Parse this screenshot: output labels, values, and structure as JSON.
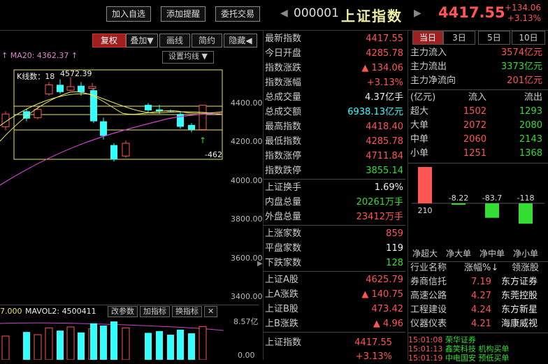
{
  "toolbar": {
    "add_favorite": "加入自选",
    "add_alert": "添加提醒",
    "entrust_trade": "委托交易"
  },
  "quote": {
    "code": "000001",
    "name": "上证指数",
    "price": "4417.55",
    "change": "+134.06",
    "change_pct": "+3.13%"
  },
  "chart": {
    "tabs": [
      "复权",
      "叠加▼",
      "画线",
      "简约",
      "隐藏◀"
    ],
    "ma20_label": "MA20: 4362.37",
    "set_ma_label": "设置均线",
    "kline_count_label": "K线数：18",
    "high_label": "4572.39",
    "low_label": "-462",
    "y_axis": [
      "4400.00",
      "4200.00",
      "4000.00",
      "3800.00",
      "3600.00",
      "3400.00"
    ],
    "vol_axis": [
      "8.57亿",
      "0.00"
    ],
    "vol_label_left": "7.000",
    "vol_label_mavol": "MAVOL2: 4500411",
    "vol_buttons": [
      "改参数",
      "加指标",
      "换指标",
      "✕"
    ]
  },
  "chart_data": {
    "type": "candlestick",
    "candles": [
      {
        "o": 4300,
        "c": 4370,
        "h": 4385,
        "l": 4280,
        "up": true
      },
      {
        "o": 4385,
        "c": 4345,
        "h": 4400,
        "l": 4330,
        "up": false
      },
      {
        "o": 4350,
        "c": 4395,
        "h": 4410,
        "l": 4340,
        "up": true
      },
      {
        "o": 4480,
        "c": 4530,
        "h": 4545,
        "l": 4470,
        "up": true
      },
      {
        "o": 4530,
        "c": 4490,
        "h": 4560,
        "l": 4480,
        "up": false
      },
      {
        "o": 4500,
        "c": 4520,
        "h": 4572,
        "l": 4495,
        "up": true
      },
      {
        "o": 4525,
        "c": 4490,
        "h": 4545,
        "l": 4470,
        "up": false
      },
      {
        "o": 4510,
        "c": 4520,
        "h": 4540,
        "l": 4490,
        "up": true
      },
      {
        "o": 4500,
        "c": 4330,
        "h": 4510,
        "l": 4320,
        "up": false
      },
      {
        "o": 4330,
        "c": 4250,
        "h": 4350,
        "l": 4230,
        "up": false
      },
      {
        "o": 4200,
        "c": 4120,
        "h": 4210,
        "l": 4110,
        "up": false
      },
      {
        "o": 4140,
        "c": 4210,
        "h": 4225,
        "l": 4130,
        "up": true
      },
      {
        "o": 4390,
        "c": 4420,
        "h": 4430,
        "l": 4380,
        "up": false
      },
      {
        "o": 4395,
        "c": 4385,
        "h": 4420,
        "l": 4370,
        "up": false
      },
      {
        "o": 4390,
        "c": 4385,
        "h": 4395,
        "l": 4380,
        "up": false
      },
      {
        "o": 4370,
        "c": 4300,
        "h": 4380,
        "l": 4290,
        "up": false
      },
      {
        "o": 4310,
        "c": 4285,
        "h": 4320,
        "l": 4270,
        "up": false
      },
      {
        "o": 4285,
        "c": 4418,
        "h": 4420,
        "l": 4280,
        "up": true
      }
    ],
    "volumes": [
      5.2,
      6.1,
      5.5,
      7.0,
      6.4,
      7.2,
      6.0,
      6.8,
      8.0,
      7.5,
      8.4,
      7.0,
      5.9,
      6.3,
      5.5,
      6.6,
      5.8,
      7.3
    ],
    "ylim": [
      3330,
      4650
    ],
    "vol_ylim": [
      0,
      8.57
    ]
  },
  "stats": [
    {
      "k": "最新指数",
      "v": "4417.55",
      "c": "red"
    },
    {
      "k": "今日开盘",
      "v": "4285.78",
      "c": "red"
    },
    {
      "k": "指数涨跌",
      "v": "▲ 134.06",
      "c": "red"
    },
    {
      "k": "指数涨幅",
      "v": "+3.13%",
      "c": "red"
    },
    {
      "k": "总成交量",
      "v": "4.37亿手",
      "c": "white"
    },
    {
      "k": "总成交额",
      "v": "6938.13亿元",
      "c": "cyan"
    },
    {
      "k": "最高指数",
      "v": "4418.40",
      "c": "red"
    },
    {
      "k": "最低指数",
      "v": "4285.78",
      "c": "red"
    },
    {
      "k": "指数涨停",
      "v": "4711.84",
      "c": "red"
    },
    {
      "k": "指数跌停",
      "v": "3855.14",
      "c": "green"
    }
  ],
  "stats2": [
    {
      "k": "上证换手",
      "v": "1.69%",
      "c": "white"
    },
    {
      "k": "内盘总量",
      "v": "20261万手",
      "c": "green"
    },
    {
      "k": "外盘总量",
      "v": "23412万手",
      "c": "red"
    }
  ],
  "stats3": [
    {
      "k": "上涨家数",
      "v": "859",
      "c": "red"
    },
    {
      "k": "平盘家数",
      "v": "119",
      "c": "white"
    },
    {
      "k": "下跌家数",
      "v": "128",
      "c": "green"
    }
  ],
  "stats4": [
    {
      "k": "上证A股",
      "v": "4625.79",
      "c": "red"
    },
    {
      "k": "上A涨跌",
      "v": "▲ 140.75",
      "c": "red"
    },
    {
      "k": "上证B股",
      "v": "473.42",
      "c": "red"
    },
    {
      "k": "上B涨跌",
      "v": "▲ 4.96",
      "c": "red"
    }
  ],
  "stats5": {
    "k": "上证指数",
    "v": "4417.55",
    "pct": "+3.13%"
  },
  "flow": {
    "tabs": [
      "当日",
      "3日",
      "5日",
      "10日"
    ],
    "inflow_label": "主力流入",
    "inflow": "3574亿元",
    "outflow_label": "主力流出",
    "outflow": "3373亿元",
    "net_label": "主力净流向",
    "net": "201亿元",
    "head_unit": "(亿元)",
    "head_in": "流入",
    "head_out": "流出",
    "rows": [
      {
        "k": "超大",
        "in": "1502",
        "out": "1293"
      },
      {
        "k": "大单",
        "in": "2072",
        "out": "2080"
      },
      {
        "k": "中单",
        "in": "2060",
        "out": "2143"
      },
      {
        "k": "小单",
        "in": "1251",
        "out": "1368"
      }
    ],
    "bars": [
      {
        "label": "210",
        "value": 210
      },
      {
        "label": "-8.22",
        "value": -8.22
      },
      {
        "label": "-83.7",
        "value": -83.7
      },
      {
        "label": "-118",
        "value": -118
      }
    ],
    "bar_labels": [
      "净超大",
      "净大单",
      "净中单",
      "净小单"
    ]
  },
  "industry": {
    "head_name": "行业名称",
    "head_pct": "涨幅%↓",
    "head_lead": "领涨股",
    "rows": [
      {
        "name": "券商信托",
        "pct": "7.19",
        "lead": "东方证券"
      },
      {
        "name": "高速公路",
        "pct": "4.27",
        "lead": "东莞控股"
      },
      {
        "name": "工程建设",
        "pct": "4.24",
        "lead": "东方新星"
      },
      {
        "name": "仪器仪表",
        "pct": "4.21",
        "lead": "海康威视"
      }
    ]
  },
  "ticker": [
    {
      "time": "15:01:08",
      "text": "荣华证券"
    },
    {
      "time": "15:01:13",
      "text": "鑫笑科技 机构买单"
    },
    {
      "time": "15:01:19",
      "text": "中电国安 预低买单"
    }
  ],
  "colors": {
    "up": "#ff5555",
    "down": "#33ffff",
    "green": "#33dd33",
    "ma_yellow": "#e8e860",
    "ma_pink": "#d040d0"
  }
}
